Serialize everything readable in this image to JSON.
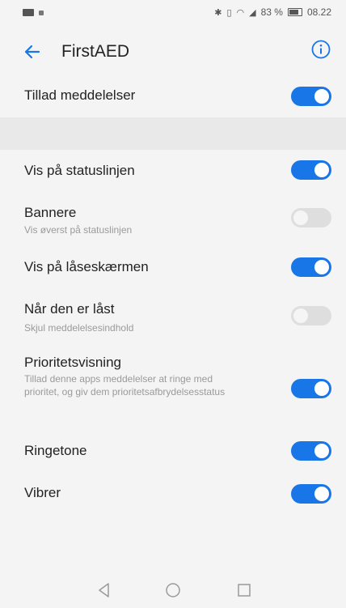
{
  "status_bar": {
    "battery_percent": "83 %",
    "time": "08.22"
  },
  "header": {
    "title": "FirstAED",
    "back_icon": "arrow-left-icon",
    "info_icon": "info-circle-icon"
  },
  "settings": [
    {
      "title": "Tillad meddelelser",
      "subtitle": "",
      "enabled": true
    },
    {
      "title": "Vis på statuslinjen",
      "subtitle": "",
      "enabled": true
    },
    {
      "title": "Bannere",
      "subtitle": "Vis øverst på statuslinjen",
      "enabled": false
    },
    {
      "title": "Vis på låseskærmen",
      "subtitle": "",
      "enabled": true
    },
    {
      "title": "Når den er låst",
      "subtitle": "Skjul meddelelsesindhold",
      "enabled": false
    },
    {
      "title": "Prioritetsvisning",
      "subtitle": "Tillad denne apps meddelelser at ringe med prioritet, og giv dem prioritetsafbrydelsesstatus",
      "enabled": true
    },
    {
      "title": "Ringetone",
      "subtitle": "",
      "enabled": true
    },
    {
      "title": "Vibrer",
      "subtitle": "",
      "enabled": true
    }
  ],
  "nav_bar": {
    "back_icon": "triangle-back-icon",
    "home_icon": "circle-home-icon",
    "recents_icon": "square-recents-icon"
  },
  "colors": {
    "accent": "#1976e6",
    "toggle_off": "#dedede"
  }
}
